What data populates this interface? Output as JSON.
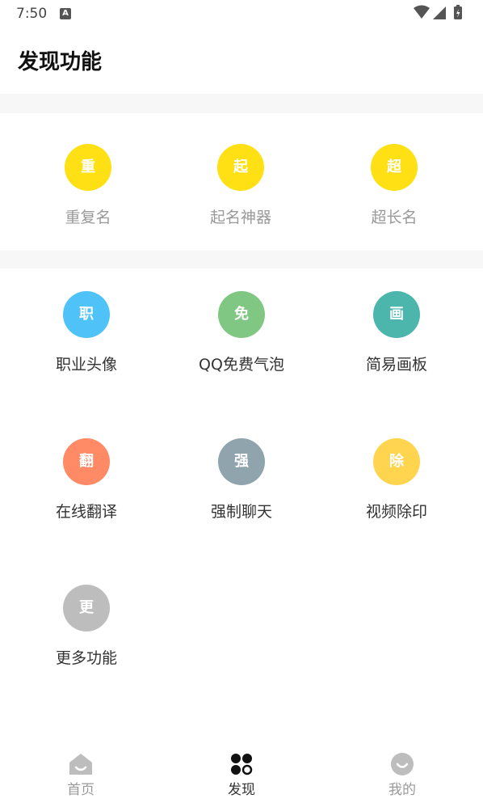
{
  "status": {
    "time": "7:50",
    "badge": "A"
  },
  "header": {
    "title": "发现功能"
  },
  "top_section": {
    "items": [
      {
        "label": "重复名",
        "icon_char": "重",
        "color": "#FFE014"
      },
      {
        "label": "起名神器",
        "icon_char": "起",
        "color": "#FFE014"
      },
      {
        "label": "超长名",
        "icon_char": "超",
        "color": "#FFE014"
      }
    ]
  },
  "features": {
    "items": [
      {
        "label": "职业头像",
        "icon_char": "职",
        "color": "#4FC3F7"
      },
      {
        "label": "QQ免费气泡",
        "icon_char": "免",
        "color": "#81C784"
      },
      {
        "label": "简易画板",
        "icon_char": "画",
        "color": "#4DB6AC"
      },
      {
        "label": "在线翻译",
        "icon_char": "翻",
        "color": "#FF8A65"
      },
      {
        "label": "强制聊天",
        "icon_char": "强",
        "color": "#90A4AE"
      },
      {
        "label": "视频除印",
        "icon_char": "除",
        "color": "#FFD54F"
      },
      {
        "label": "更多功能",
        "icon_char": "更",
        "color": "#BDBDBD"
      }
    ]
  },
  "nav": {
    "items": [
      {
        "label": "首页",
        "icon": "home-icon"
      },
      {
        "label": "发现",
        "icon": "discover-icon"
      },
      {
        "label": "我的",
        "icon": "profile-icon"
      }
    ],
    "active_color": "#111111",
    "inactive_color": "#BDBDBD"
  }
}
